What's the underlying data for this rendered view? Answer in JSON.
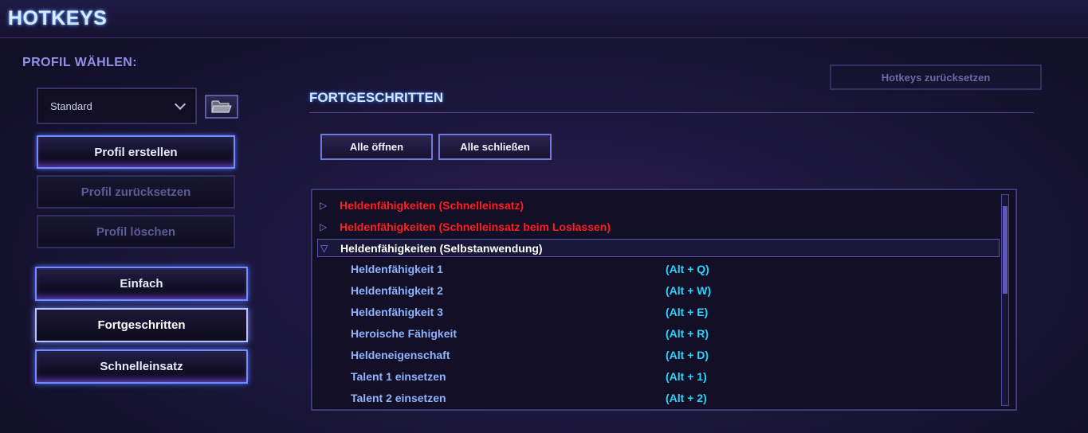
{
  "header": {
    "title": "HOTKEYS"
  },
  "profile": {
    "section_label": "PROFIL WÄHLEN:",
    "selected": "Standard",
    "buttons": {
      "create": "Profil erstellen",
      "reset": "Profil zurücksetzen",
      "delete": "Profil löschen"
    }
  },
  "modes": {
    "simple": "Einfach",
    "advanced": "Fortgeschritten",
    "quickcast": "Schnelleinsatz"
  },
  "reset_hotkeys": "Hotkeys zurücksetzen",
  "panel": {
    "title": "FORTGESCHRITTEN",
    "open_all": "Alle öffnen",
    "close_all": "Alle schließen"
  },
  "list": {
    "categories": [
      {
        "label": "Heldenfähigkeiten (Schnelleinsatz)",
        "state": "collapsed"
      },
      {
        "label": "Heldenfähigkeiten (Schnelleinsatz beim Loslassen)",
        "state": "collapsed"
      },
      {
        "label": "Heldenfähigkeiten (Selbstanwendung)",
        "state": "expanded"
      }
    ],
    "items": [
      {
        "name": "Heldenfähigkeit 1",
        "key": "(Alt + Q)"
      },
      {
        "name": "Heldenfähigkeit 2",
        "key": "(Alt + W)"
      },
      {
        "name": "Heldenfähigkeit 3",
        "key": "(Alt + E)"
      },
      {
        "name": "Heroische Fähigkeit",
        "key": "(Alt + R)"
      },
      {
        "name": "Heldeneigenschaft",
        "key": "(Alt + D)"
      },
      {
        "name": "Talent 1 einsetzen",
        "key": "(Alt + 1)"
      },
      {
        "name": "Talent 2 einsetzen",
        "key": "(Alt + 2)"
      }
    ],
    "scroll_position": 0.05
  },
  "colors": {
    "accent_blue": "#6f8cff",
    "category_red": "#ff1e1e",
    "item_name": "#8fb3ff",
    "key_cyan": "#26d6ff"
  }
}
